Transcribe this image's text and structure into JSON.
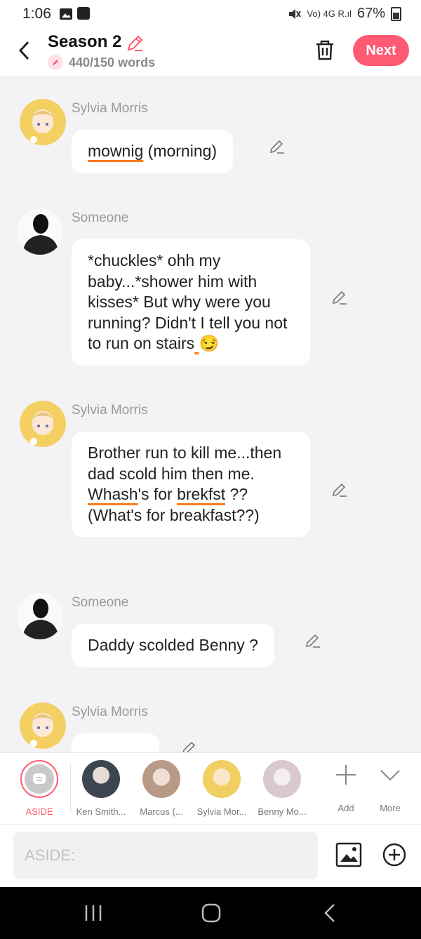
{
  "status": {
    "time": "1:06",
    "signal": "Vo) 4G R.ıl",
    "battery": "67%"
  },
  "header": {
    "title": "Season 2",
    "word_count": "440/150 words",
    "next_label": "Next"
  },
  "messages": [
    {
      "speaker": "Sylvia Morris",
      "parts": [
        {
          "t": "mownig",
          "u": true
        },
        {
          "t": " (morning)",
          "u": false
        }
      ]
    },
    {
      "speaker": "Someone",
      "parts": [
        {
          "t": "*chuckles* ohh my baby...*shower him with kisses* But why were you running? Didn't I tell you not to run on stairs",
          "u": false
        },
        {
          "t": " ",
          "u": true
        },
        {
          "t": "😏",
          "u": false
        }
      ]
    },
    {
      "speaker": "Sylvia Morris",
      "parts": [
        {
          "t": "Brother run to kill me...then dad scold him then me. ",
          "u": false
        },
        {
          "t": "Whash",
          "u": true
        },
        {
          "t": "'s for ",
          "u": false
        },
        {
          "t": "brekfst",
          "u": true
        },
        {
          "t": " ?? (What's for breakfast??)",
          "u": false
        }
      ]
    },
    {
      "speaker": "Someone",
      "parts": [
        {
          "t": "Daddy scolded Benny ?",
          "u": false
        }
      ]
    },
    {
      "speaker": "Sylvia Morris",
      "parts": [
        {
          "t": "...",
          "u": false
        }
      ]
    }
  ],
  "characters": [
    {
      "label": "ASIDE",
      "kind": "aside"
    },
    {
      "label": "Ken Smith...",
      "color": "#3c4550"
    },
    {
      "label": "Marcus (...",
      "color": "#b89a86"
    },
    {
      "label": "Sylvia Mor...",
      "color": "#f2cf63"
    },
    {
      "label": "Benny Mo...",
      "color": "#d9c9cc"
    }
  ],
  "add_label": "Add",
  "more_label": "More",
  "input": {
    "placeholder": "ASIDE:"
  },
  "colors": {
    "accent": "#ff5a73",
    "underline": "#ff7a1a",
    "background": "#f3f3f5"
  }
}
